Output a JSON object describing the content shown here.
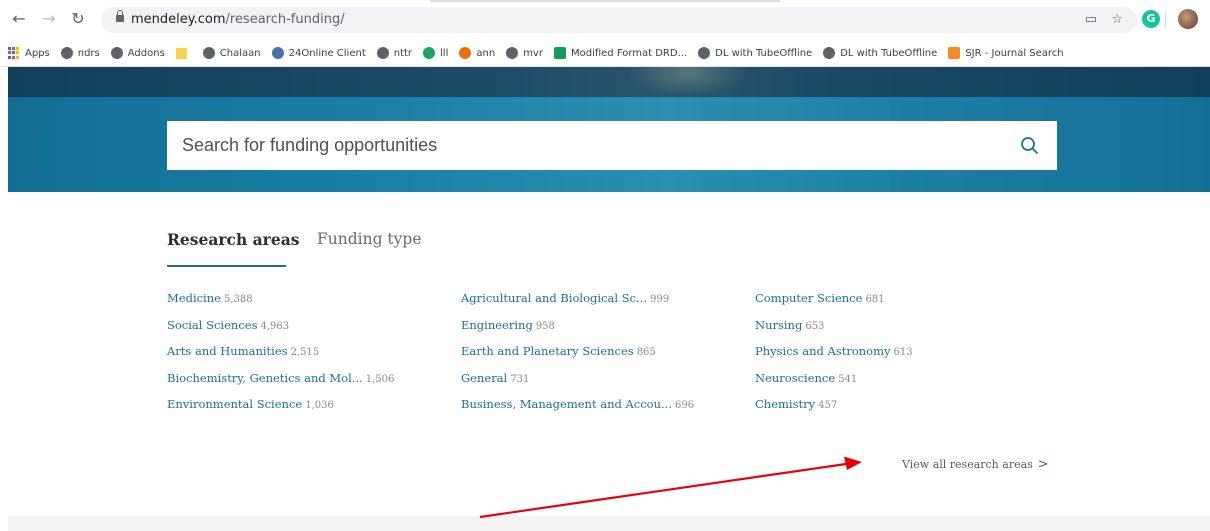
{
  "browser": {
    "url_host": "mendeley.com",
    "url_path": "/research-funding/",
    "bookmarks": [
      {
        "label": "Apps",
        "icon": "apps-grid-icon"
      },
      {
        "label": "ndrs",
        "icon": "globe-icon"
      },
      {
        "label": "Addons",
        "icon": "globe-icon"
      },
      {
        "label": "",
        "icon": "folder-icon"
      },
      {
        "label": "Chalaan",
        "icon": "globe-icon"
      },
      {
        "label": "24Online Client",
        "icon": "cloud-icon"
      },
      {
        "label": "nttr",
        "icon": "globe-icon"
      },
      {
        "label": "lll",
        "icon": "drive-icon"
      },
      {
        "label": "ann",
        "icon": "orange-icon"
      },
      {
        "label": "mvr",
        "icon": "globe-icon"
      },
      {
        "label": "Modified Format DRD...",
        "icon": "sheets-icon"
      },
      {
        "label": "DL with TubeOffline",
        "icon": "globe-icon"
      },
      {
        "label": "DL with TubeOffline",
        "icon": "globe-icon"
      },
      {
        "label": "SJR - Journal Search",
        "icon": "sjr-icon"
      }
    ]
  },
  "search": {
    "placeholder": "Search for funding opportunities"
  },
  "tabs": {
    "research_areas": "Research areas",
    "funding_type": "Funding type"
  },
  "research_areas": {
    "columns": [
      [
        {
          "name": "Medicine",
          "count": "5,388"
        },
        {
          "name": "Social Sciences",
          "count": "4,963"
        },
        {
          "name": "Arts and Humanities",
          "count": "2,515"
        },
        {
          "name": "Biochemistry, Genetics and Mol...",
          "count": "1,506"
        },
        {
          "name": "Environmental Science",
          "count": "1,036"
        }
      ],
      [
        {
          "name": "Agricultural and Biological Sc...",
          "count": "999"
        },
        {
          "name": "Engineering",
          "count": "958"
        },
        {
          "name": "Earth and Planetary Sciences",
          "count": "865"
        },
        {
          "name": "General",
          "count": "731"
        },
        {
          "name": "Business, Management and Accou...",
          "count": "696"
        }
      ],
      [
        {
          "name": "Computer Science",
          "count": "681"
        },
        {
          "name": "Nursing",
          "count": "653"
        },
        {
          "name": "Physics and Astronomy",
          "count": "613"
        },
        {
          "name": "Neuroscience",
          "count": "541"
        },
        {
          "name": "Chemistry",
          "count": "457"
        }
      ]
    ],
    "view_all": "View all research areas"
  },
  "colors": {
    "link": "#1b6f96",
    "hero": "#1a7fa5",
    "annotation_arrow": "#e8000b"
  }
}
